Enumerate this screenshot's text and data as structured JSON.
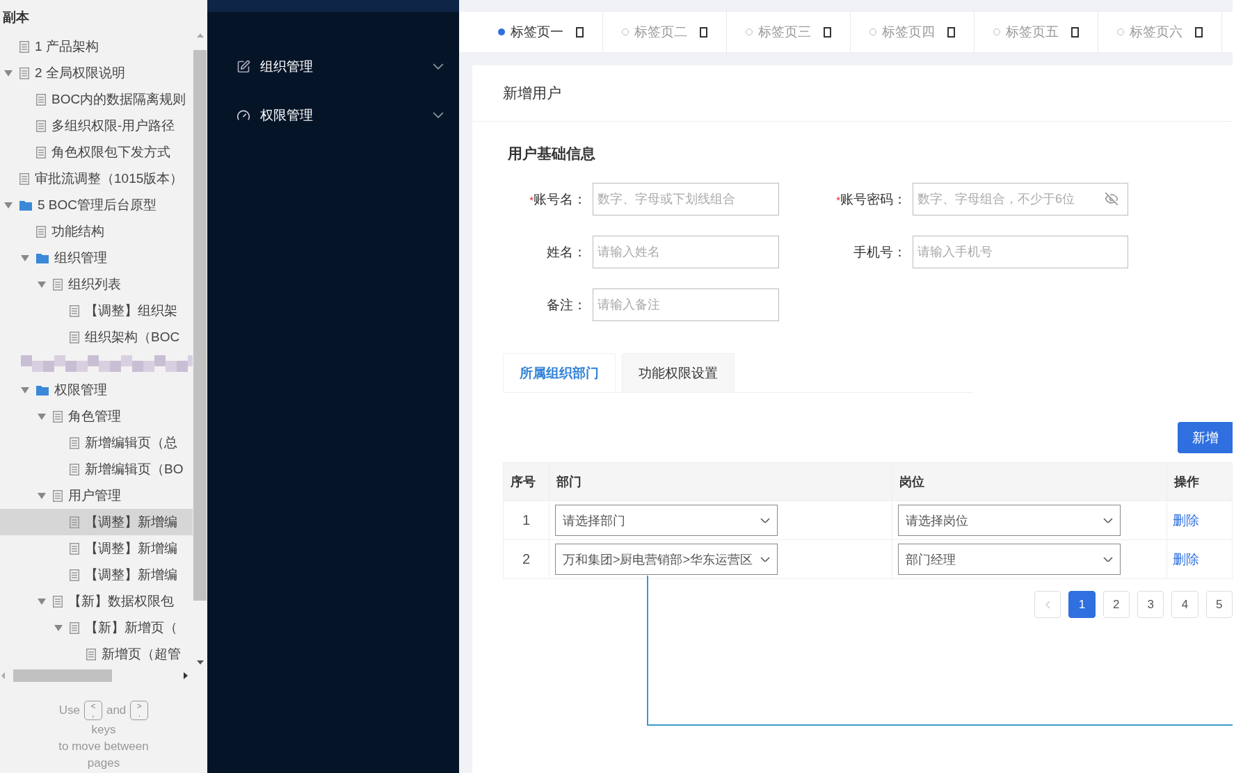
{
  "doc_tree": {
    "title": "副本",
    "items": [
      {
        "label": "1 产品架构",
        "kind": "page"
      },
      {
        "label": "2 全局权限说明",
        "kind": "page",
        "expanded": true,
        "children": [
          {
            "label": "BOC内的数据隔离规则",
            "kind": "page"
          },
          {
            "label": "多组织权限-用户路径",
            "kind": "page"
          },
          {
            "label": "角色权限包下发方式",
            "kind": "page"
          }
        ]
      },
      {
        "label": "审批流调整（1015版本）",
        "kind": "page"
      },
      {
        "label": "5 BOC管理后台原型",
        "kind": "folder",
        "expanded": true,
        "children": [
          {
            "label": "功能结构",
            "kind": "page"
          },
          {
            "label": "组织管理",
            "kind": "folder",
            "expanded": true,
            "children": [
              {
                "label": "组织列表",
                "kind": "page",
                "expanded": true,
                "children": [
                  {
                    "label": "【调整】组织架",
                    "kind": "page"
                  },
                  {
                    "label": "组织架构（BOC",
                    "kind": "page"
                  }
                ]
              }
            ]
          },
          {
            "kind": "redacted"
          },
          {
            "label": "权限管理",
            "kind": "folder",
            "expanded": true,
            "children": [
              {
                "label": "角色管理",
                "kind": "page",
                "expanded": true,
                "children": [
                  {
                    "label": "新增编辑页（总",
                    "kind": "page"
                  },
                  {
                    "label": "新增编辑页（BO",
                    "kind": "page"
                  }
                ]
              },
              {
                "label": "用户管理",
                "kind": "page",
                "expanded": true,
                "children": [
                  {
                    "label": "【调整】新增编",
                    "kind": "page",
                    "selected": true
                  },
                  {
                    "label": "【调整】新增编",
                    "kind": "page",
                    "selected": false
                  },
                  {
                    "label": "【调整】新增编",
                    "kind": "page",
                    "selected": false
                  }
                ]
              },
              {
                "label": "【新】数据权限包",
                "kind": "page",
                "expanded": true,
                "children": [
                  {
                    "label": "【新】新增页（",
                    "kind": "page",
                    "expanded": true,
                    "children": [
                      {
                        "label": "新增页（超管",
                        "kind": "page"
                      }
                    ]
                  }
                ]
              }
            ]
          }
        ]
      }
    ]
  },
  "key_hint": {
    "before": "Use",
    "keys": [
      {
        "top": "<",
        "bottom": ","
      },
      {
        "top": ">",
        "bottom": "."
      }
    ],
    "between": "and",
    "after": "keys",
    "line2": "to move between",
    "line3": "pages"
  },
  "nav_menu": [
    {
      "label": "组织管理",
      "expanded": false
    },
    {
      "label": "权限管理",
      "expanded": false
    }
  ],
  "tabs": [
    {
      "label": "标签页一",
      "selected": true
    },
    {
      "label": "标签页二",
      "selected": false
    },
    {
      "label": "标签页三",
      "selected": false
    },
    {
      "label": "标签页四",
      "selected": false
    },
    {
      "label": "标签页五",
      "selected": false
    },
    {
      "label": "标签页六",
      "selected": false
    }
  ],
  "form": {
    "title": "新增用户",
    "section": "用户基础信息",
    "fields": [
      {
        "label": "账号名：",
        "required_mark": "*",
        "placeholder": "数字、字母或下划线组合",
        "kind": "text"
      },
      {
        "label": "账号密码：",
        "required_mark": "*",
        "placeholder": "数字、字母组合，不少于6位",
        "kind": "password"
      },
      {
        "label": "姓名：",
        "placeholder": "请输入姓名",
        "kind": "text"
      },
      {
        "label": "手机号：",
        "placeholder": "请输入手机号",
        "kind": "text"
      },
      {
        "label": "备注：",
        "placeholder": "请输入备注",
        "kind": "text"
      }
    ]
  },
  "sub_tabs": [
    {
      "label": "所属组织部门",
      "selected": true
    },
    {
      "label": "功能权限设置",
      "selected": false
    }
  ],
  "add_button": "新增",
  "table": {
    "columns": [
      "序号",
      "部门",
      "岗位",
      "操作"
    ],
    "rows": [
      {
        "index": "1",
        "department": "请选择部门",
        "position": "请选择岗位",
        "action": "删除"
      },
      {
        "index": "2",
        "department": "万和集团>厨电营销部>华东运营区",
        "position": "部门经理",
        "action": "删除"
      }
    ]
  },
  "pagination": {
    "prev_disabled": true,
    "pages": [
      {
        "label": "1",
        "selected": true
      },
      {
        "label": "2",
        "selected": false
      },
      {
        "label": "3",
        "selected": false
      },
      {
        "label": "4",
        "selected": false
      },
      {
        "label": "5",
        "selected": false
      }
    ]
  }
}
